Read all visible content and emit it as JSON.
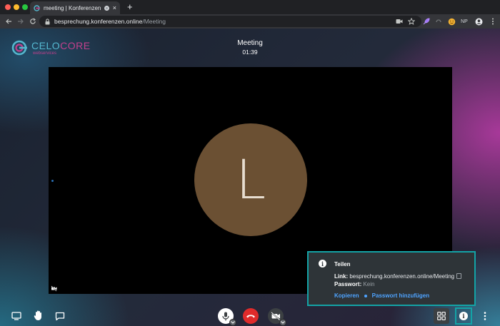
{
  "browser": {
    "tab_title": "meeting | Konferenzen Online",
    "tab_close": "×",
    "new_tab": "+",
    "url_host": "besprechung.konferenzen.online",
    "url_path": "/Meeting",
    "extensions": [
      "camera-icon",
      "star-icon",
      "feather-icon",
      "refresh-icon",
      "emoji-icon",
      "NP",
      "avatar-icon",
      "menu-icon"
    ],
    "extension_np": "NP"
  },
  "logo": {
    "name_part1": "CELO",
    "name_part2": "CORE",
    "subtitle": "webservices",
    "colors": {
      "teal": "#55b7cf",
      "magenta": "#c2408c"
    }
  },
  "meeting": {
    "title": "Meeting",
    "timer": "01:39",
    "participant_initial": "L",
    "avatar_color": "#6b5033"
  },
  "share_popup": {
    "title": "Teilen",
    "link_label": "Link:",
    "link_value": "besprechung.konferenzen.online/Meeting",
    "password_label": "Passwort:",
    "password_value": "Kein",
    "copy_action": "Kopieren",
    "add_password_action": "Passwort hinzufügen",
    "accent": "#13a3a6"
  },
  "toolbar": {
    "left": [
      "screen-share-icon",
      "raise-hand-icon",
      "chat-icon"
    ],
    "center": [
      "microphone-icon",
      "hangup-icon",
      "camera-off-icon"
    ],
    "right": [
      "tile-view-icon",
      "info-icon",
      "more-options-icon"
    ],
    "hangup_color": "#e02b2b"
  }
}
